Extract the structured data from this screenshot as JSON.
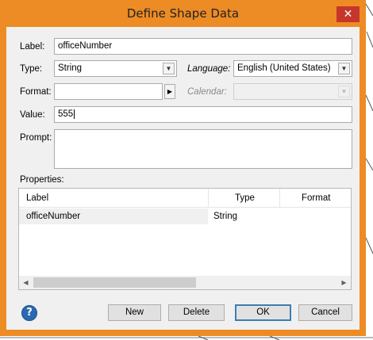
{
  "window": {
    "title": "Define Shape Data",
    "close_glyph": "✕"
  },
  "form": {
    "label_caption": "Label:",
    "label_value": "officeNumber",
    "type_caption": "Type:",
    "type_value": "String",
    "language_caption": "Language:",
    "language_value": "English (United States)",
    "format_caption": "Format:",
    "format_value": "",
    "calendar_caption": "Calendar:",
    "calendar_value": "",
    "value_caption": "Value:",
    "value_value": "555",
    "prompt_caption": "Prompt:",
    "prompt_value": ""
  },
  "properties": {
    "caption": "Properties:",
    "columns": [
      "Label",
      "Type",
      "Format"
    ],
    "rows": [
      {
        "label": "officeNumber",
        "type": "String",
        "format": ""
      }
    ]
  },
  "buttons": {
    "help": "?",
    "new": "New",
    "delete": "Delete",
    "ok": "OK",
    "cancel": "Cancel"
  },
  "colors": {
    "window_border": "#ed8b25",
    "close_button": "#c7362b",
    "help_button": "#2a6ab3"
  },
  "icons": {
    "dropdown": "chevron-down-icon",
    "format_picker": "triangle-right-icon",
    "scroll_left": "triangle-left-icon",
    "scroll_right": "triangle-right-icon",
    "help": "help-icon",
    "close": "close-icon"
  }
}
